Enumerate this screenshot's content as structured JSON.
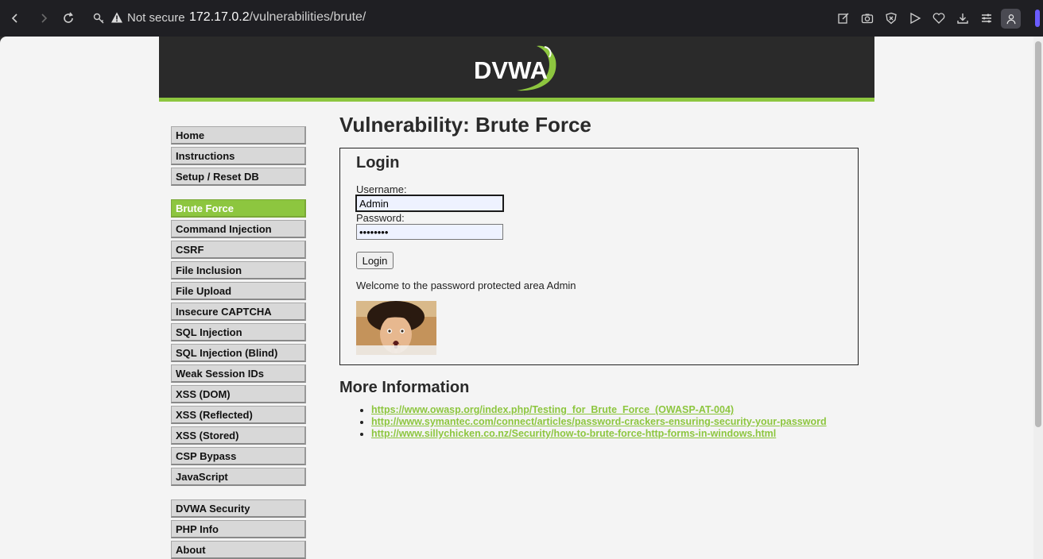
{
  "browser": {
    "security_label": "Not secure",
    "url_host": "172.17.0.2",
    "url_path": "/vulnerabilities/brute/",
    "accent": "#6a5cff"
  },
  "site": {
    "logo_text": "DVWA",
    "brand_green": "#8dc63f",
    "header_bg": "#2a2a2a"
  },
  "menu": {
    "group1": [
      {
        "label": "Home"
      },
      {
        "label": "Instructions"
      },
      {
        "label": "Setup / Reset DB"
      }
    ],
    "group2": [
      {
        "label": "Brute Force",
        "active": true
      },
      {
        "label": "Command Injection"
      },
      {
        "label": "CSRF"
      },
      {
        "label": "File Inclusion"
      },
      {
        "label": "File Upload"
      },
      {
        "label": "Insecure CAPTCHA"
      },
      {
        "label": "SQL Injection"
      },
      {
        "label": "SQL Injection (Blind)"
      },
      {
        "label": "Weak Session IDs"
      },
      {
        "label": "XSS (DOM)"
      },
      {
        "label": "XSS (Reflected)"
      },
      {
        "label": "XSS (Stored)"
      },
      {
        "label": "CSP Bypass"
      },
      {
        "label": "JavaScript"
      }
    ],
    "group3": [
      {
        "label": "DVWA Security"
      },
      {
        "label": "PHP Info"
      },
      {
        "label": "About"
      }
    ]
  },
  "main": {
    "title": "Vulnerability: Brute Force",
    "login": {
      "heading": "Login",
      "username_label": "Username:",
      "username_value": "Admin",
      "password_label": "Password:",
      "password_value": "password",
      "button_label": "Login",
      "welcome_message": "Welcome to the password protected area Admin"
    },
    "more_info": {
      "heading": "More Information",
      "links": [
        "https://www.owasp.org/index.php/Testing_for_Brute_Force_(OWASP-AT-004)",
        "http://www.symantec.com/connect/articles/password-crackers-ensuring-security-your-password",
        "http://www.sillychicken.co.nz/Security/how-to-brute-force-http-forms-in-windows.html"
      ]
    }
  }
}
